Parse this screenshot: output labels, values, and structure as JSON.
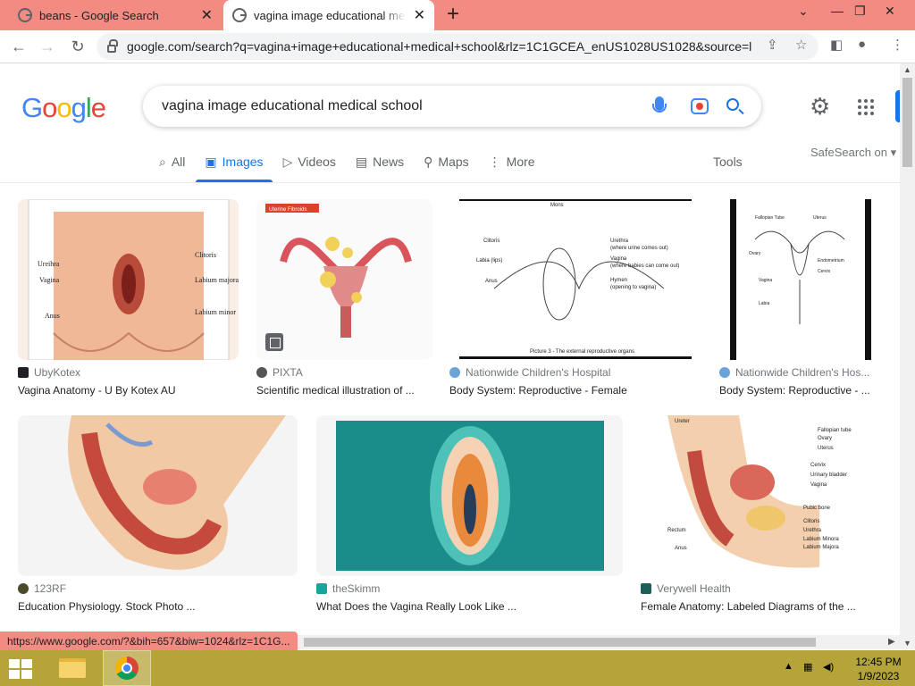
{
  "browser": {
    "tabs": [
      {
        "title": "beans - Google Search",
        "active": false
      },
      {
        "title": "vagina image educational medical school",
        "active": true
      }
    ],
    "new_tab": "+",
    "url": "google.com/search?q=vagina+image+educational+medical+school&rlz=1C1GCEA_enUS1028US1028&source=l...",
    "status_url": "https://www.google.com/?&bih=657&biw=1024&rlz=1C1G..."
  },
  "google": {
    "logo_letters": [
      "G",
      "o",
      "o",
      "g",
      "l",
      "e"
    ],
    "query": "vagina image educational medical school",
    "nav_tabs": [
      {
        "label": "All",
        "icon": "search-icon",
        "active": false
      },
      {
        "label": "Images",
        "icon": "image-icon",
        "active": true
      },
      {
        "label": "Videos",
        "icon": "video-icon",
        "active": false
      },
      {
        "label": "News",
        "icon": "news-icon",
        "active": false
      },
      {
        "label": "Maps",
        "icon": "map-pin-icon",
        "active": false
      },
      {
        "label": "More",
        "icon": "more-vert-icon",
        "active": false
      }
    ],
    "tools_label": "Tools",
    "safesearch_label": "SafeSearch on"
  },
  "results": [
    {
      "source": "UbyKotex",
      "caption": "Vagina Anatomy - U By Kotex AU",
      "thumb_desc": "Ureihra,Clitoris,Vagina,Labium majora,Labium minor,Anus"
    },
    {
      "source": "PIXTA",
      "caption": "Scientific medical illustration of ...",
      "thumb_desc": "Uterine Fibroids"
    },
    {
      "source": "Nationwide Children's Hospital",
      "caption": "Body System: Reproductive - Female",
      "thumb_desc": "Mons,Clitoris,Labia (lips),Anus,Urethra,Vagina,Hymen"
    },
    {
      "source": "Nationwide Children's Hos...",
      "caption": "Body System: Reproductive - ...",
      "thumb_desc": "Fallopian Tube,Uterus,Ovary,Endometrium,Cervix,Vagina,Labia"
    },
    {
      "source": "123RF",
      "caption": "Education Physiology. Stock Photo ...",
      "thumb_desc": ""
    },
    {
      "source": "theSkimm",
      "caption": "What Does the Vagina Really Look Like ...",
      "thumb_desc": ""
    },
    {
      "source": "Verywell Health",
      "caption": "Female Anatomy: Labeled Diagrams of the ...",
      "thumb_desc": "Ureter,Fallopian tube,Ovary,Uterus,Cervix,Urinary bladder,Vagina,Pubic bone,Rectum,Clitoris,Urethra,Anus,Labium Minora,Labium Majora"
    }
  ],
  "thumb_labels": {
    "kotex": [
      "Ureihra",
      "Clitoris",
      "Vagina",
      "Labium majora",
      "Labium minor",
      "Anus"
    ],
    "pixta": [
      "Uterine Fibroids"
    ],
    "nch1": [
      "Mons",
      "Clitoris",
      "Labia (lips)",
      "Anus",
      "Urethra",
      "(where urine comes out)",
      "Vagina",
      "(where babies can come out)",
      "Hymen",
      "(opening to vagina)",
      "Picture 3 - The external reproductive organs"
    ],
    "nch2": [
      "Fallopian Tube",
      "Uterus",
      "Ovary",
      "Endometrium",
      "Cervix",
      "Vagina",
      "Labia"
    ],
    "verywell": [
      "Ureter",
      "Fallopian tube",
      "Ovary",
      "Uterus",
      "Cervix",
      "Urinary bladder",
      "Vagina",
      "Pubic bone",
      "Rectum",
      "Clitoris",
      "Urethra",
      "Anus",
      "Labium Minora",
      "Labium Majora"
    ]
  },
  "taskbar": {
    "time": "12:45 PM",
    "date": "1/9/2023"
  },
  "colors": {
    "chrome_frame": "#f28b82",
    "taskbar": "#b5a43a",
    "link_blue": "#1a73e8"
  }
}
